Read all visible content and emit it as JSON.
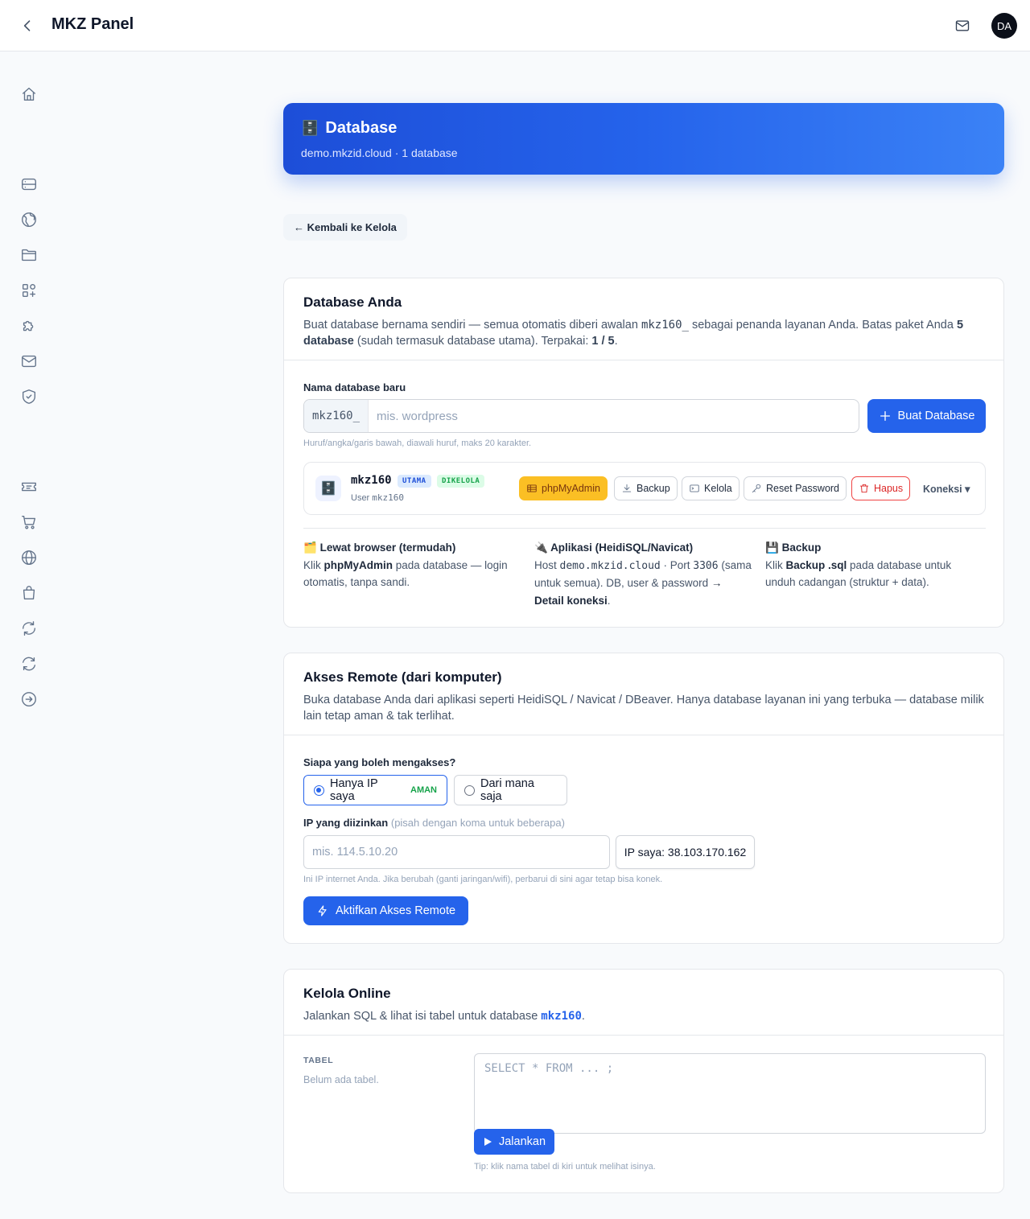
{
  "header": {
    "title": "MKZ Panel",
    "avatar_initials": "DA"
  },
  "sidebar": {
    "items": [
      {
        "name": "home-icon"
      },
      {
        "name": "server-icon"
      },
      {
        "name": "globe-icon"
      },
      {
        "name": "folder-icon"
      },
      {
        "name": "apps-icon"
      },
      {
        "name": "puzzle-icon"
      },
      {
        "name": "mail-icon"
      },
      {
        "name": "shield-icon"
      },
      {
        "name": "ticket-icon"
      },
      {
        "name": "cart-icon"
      },
      {
        "name": "world-icon"
      },
      {
        "name": "bag-icon"
      },
      {
        "name": "refresh-icon"
      },
      {
        "name": "sync-icon"
      },
      {
        "name": "logout-icon"
      }
    ]
  },
  "hero": {
    "title": "Database",
    "subtitle": "demo.mkzid.cloud · 1 database"
  },
  "back_link": "← Kembali ke Kelola",
  "db_card": {
    "title": "Database Anda",
    "desc_1": "Buat database bernama sendiri — semua otomatis diberi awalan ",
    "desc_prefix": "mkz160_",
    "desc_2": " sebagai penanda layanan Anda. Batas paket Anda ",
    "desc_limit": "5 database",
    "desc_3": " (sudah termasuk database utama). Terpakai: ",
    "desc_used": "1 / 5",
    "desc_4": ".",
    "new_label": "Nama database baru",
    "prefix": "mkz160_",
    "placeholder": "mis. wordpress",
    "create_button": "Buat Database",
    "hint": "Huruf/angka/garis bawah, diawali huruf, maks 20 karakter.",
    "row": {
      "name": "mkz160",
      "badge_main": "UTAMA",
      "badge_managed": "DIKELOLA",
      "user_label": "User",
      "user": "mkz160",
      "phpmyadmin": "phpMyAdmin",
      "backup": "Backup",
      "manage": "Kelola",
      "reset": "Reset Password",
      "delete": "Hapus",
      "connection": "Koneksi ▾"
    },
    "info": {
      "browser_title": "Lewat browser (termudah)",
      "browser_1": "Klik ",
      "browser_b": "phpMyAdmin",
      "browser_2": " pada database — login otomatis, tanpa sandi.",
      "app_title": "Aplikasi (HeidiSQL/Navicat)",
      "app_1": "Host ",
      "app_host": "demo.mkzid.cloud",
      "app_2": " · Port ",
      "app_port": "3306",
      "app_3": " (sama untuk semua). DB, user & password ",
      "app_b": "→ Detail koneksi",
      "app_4": ".",
      "backup_title": "Backup",
      "backup_1": "Klik ",
      "backup_b": "Backup .sql",
      "backup_2": " pada database untuk unduh cadangan (struktur + data)."
    }
  },
  "remote_card": {
    "title": "Akses Remote (dari komputer)",
    "desc": "Buka database Anda dari aplikasi seperti HeidiSQL / Navicat / DBeaver. Hanya database layanan ini yang terbuka — database milik lain tetap aman & tak terlihat.",
    "who_label": "Siapa yang boleh mengakses?",
    "opt_my_ip": "Hanya IP saya",
    "opt_safe": "AMAN",
    "opt_any": "Dari mana saja",
    "ip_label": "IP yang diizinkan",
    "ip_label_hint": "(pisah dengan koma untuk beberapa)",
    "ip_placeholder": "mis. 114.5.10.20",
    "my_ip_button": "IP saya: 38.103.170.162",
    "ip_hint": "Ini IP internet Anda. Jika berubah (ganti jaringan/wifi), perbarui di sini agar tetap bisa konek.",
    "activate_button": "Aktifkan Akses Remote"
  },
  "online_card": {
    "title": "Kelola Online",
    "desc_1": "Jalankan SQL & lihat isi tabel untuk database ",
    "desc_db": "mkz160",
    "desc_2": ".",
    "tables_label": "TABEL",
    "no_tables": "Belum ada tabel.",
    "sql_placeholder": "SELECT * FROM ... ;",
    "run_button": "Jalankan",
    "tip": "Tip: klik nama tabel di kiri untuk melihat isinya."
  },
  "colors": {
    "primary": "#2563eb",
    "warning": "#fbbf24",
    "danger": "#dc2626",
    "success": "#16a34a"
  }
}
